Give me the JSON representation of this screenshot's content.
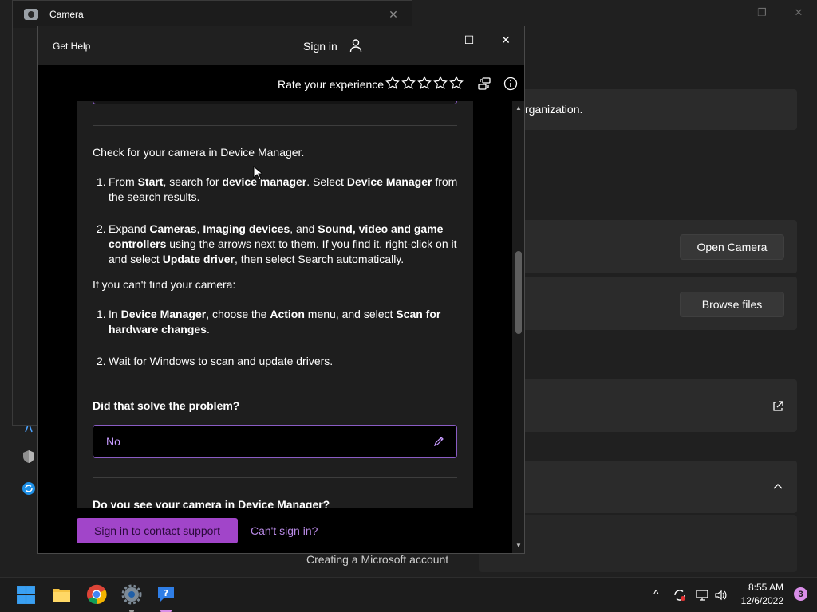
{
  "background_settings": {
    "caption": {
      "minimize": "—",
      "maximize": "❐",
      "close": "✕"
    },
    "org_text": "rganization.",
    "open_camera_label": "Open Camera",
    "browse_files_label": "Browse files",
    "account_text": "Creating a Microsoft account"
  },
  "camera_window": {
    "title": "Camera",
    "close": "✕"
  },
  "help_window": {
    "app_title": "Get Help",
    "sign_in_label": "Sign in",
    "caption": {
      "minimize": "—",
      "maximize": "☐",
      "close": "✕"
    },
    "rate_label": "Rate your experience",
    "stars": 5,
    "content": {
      "intro": "Check for your camera in Device Manager.",
      "steps_a": [
        {
          "num": "1.",
          "t1": "From ",
          "b1": "Start",
          "t2": ", search for ",
          "b2": "device manager",
          "t3": ". Select ",
          "b3": "Device Manager",
          "t4": " from the search results."
        },
        {
          "num": "2.",
          "t1": "Expand ",
          "b1": "Cameras",
          "t2": ", ",
          "b2": "Imaging devices",
          "t3": ", and ",
          "b3": "Sound, video and game controllers",
          "t4": " using the arrows next to them. If you find it, right-click on it and select ",
          "b4": "Update driver",
          "t5": ", then select Search automatically."
        }
      ],
      "cant_find": "If you can't find your camera:",
      "steps_b": [
        {
          "num": "1.",
          "t1": "In ",
          "b1": "Device Manager",
          "t2": ", choose the ",
          "b2": "Action",
          "t3": " menu, and select ",
          "b3": "Scan for hardware changes",
          "t4": "."
        },
        {
          "num": "2.",
          "t1": "Wait for Windows to scan and update drivers."
        }
      ],
      "question_1": "Did that solve the problem?",
      "answer_1": "No",
      "question_2": "Do you see your camera in Device Manager?"
    },
    "footer": {
      "contact_button": "Sign in to contact support",
      "cant_sign_in": "Can't sign in?"
    }
  },
  "taskbar": {
    "time": "8:55 AM",
    "date": "12/6/2022",
    "notification_count": "3",
    "tray_chevron": "^"
  },
  "colors": {
    "accent": "#a145c9",
    "accent_light": "#c79bff",
    "border_accent": "#8a5cc4"
  }
}
